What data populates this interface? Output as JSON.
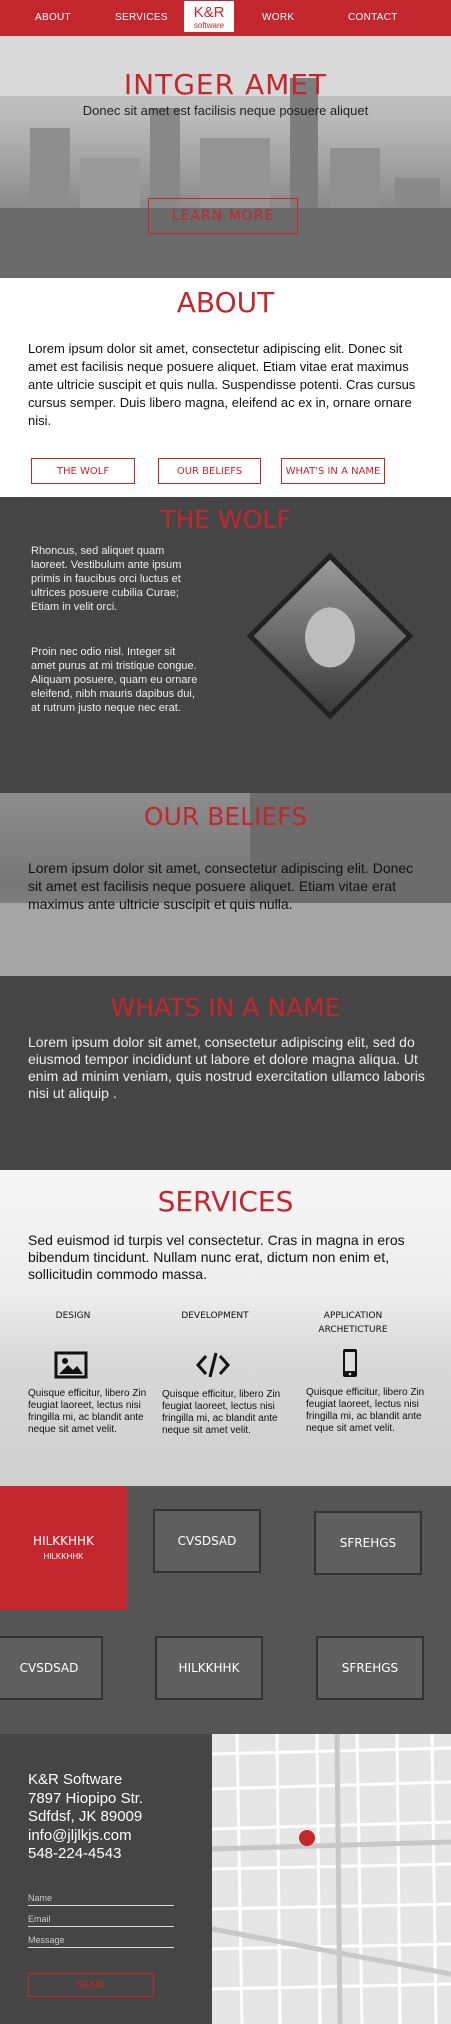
{
  "nav": {
    "items": [
      "ABOUT",
      "SERVICES",
      "WORK",
      "CONTACT"
    ],
    "logo_main": "K&R",
    "logo_sub": "software"
  },
  "hero": {
    "title": "INTGER AMET",
    "subtitle": "Donec sit amet est facilisis neque posuere aliquet",
    "button": "LEARN MORE"
  },
  "about": {
    "title": "ABOUT",
    "text": "Lorem ipsum dolor sit amet, consectetur adipiscing elit. Donec sit amet est facilisis neque posuere aliquet. Etiam vitae erat maximus ante ultricie suscipit et quis nulla. Suspendisse potenti. Cras cursus cursus semper. Duis libero magna, eleifend ac ex in, ornare ornare nisi.",
    "buttons": [
      "THE WOLF",
      "OUR BELIEFS",
      "WHAT'S IN A NAME"
    ]
  },
  "wolf": {
    "title": "THE WOLF",
    "para1": "Rhoncus, sed aliquet quam laoreet. Vestibulum ante ipsum primis in faucibus orci luctus et ultrices posuere cubilia Curae; Etiam in velit orci.",
    "para2": "Proin nec odio nisl. Integer sit amet purus at mi tristique congue. Aliquam posuere, quam eu ornare eleifend, nibh mauris dapibus dui, at rutrum justo neque nec erat."
  },
  "beliefs": {
    "title": "OUR BELIEFS",
    "text": "Lorem ipsum dolor sit amet, consectetur adipiscing elit. Donec sit amet est facilisis neque posuere aliquet. Etiam vitae erat maximus ante ultricie suscipit et quis nulla."
  },
  "whats": {
    "title": "WHATS IN A NAME",
    "text": "Lorem ipsum dolor sit amet, consectetur adipiscing elit, sed do eiusmod tempor incididunt ut labore et dolore magna aliqua. Ut enim ad minim veniam, quis nostrud exercitation ullamco laboris nisi ut aliquip ."
  },
  "services": {
    "title": "SERVICES",
    "text": "Sed euismod id turpis vel consectetur. Cras in magna in eros bibendum tincidunt. Nullam nunc erat, dictum non enim et, sollicitudin commodo massa.",
    "columns": [
      {
        "title": "DESIGN",
        "icon": "image-icon",
        "text": "Quisque efficitur, libero Zin feugiat laoreet, lectus nisi fringilla mi, ac blandit ante neque sit amet velit."
      },
      {
        "title": "DEVELOPMENT",
        "icon": "code-icon",
        "text": "Quisque efficitur, libero Zin feugiat laoreet, lectus nisi fringilla mi, ac blandit ante neque sit amet velit."
      },
      {
        "title": "APPLICATION ARCHETICTURE",
        "icon": "phone-icon",
        "text": "Quisque efficitur, libero Zin feugiat laoreet, lectus nisi fringilla mi, ac blandit ante neque sit amet velit."
      }
    ]
  },
  "work": {
    "featured_title": "HILKKHHK",
    "featured_sub": "HILKKHHK",
    "tiles": [
      "CVSDSAD",
      "SFREHGS",
      "CVSDSAD",
      "HILKKHHK",
      "SFREHGS"
    ]
  },
  "contact": {
    "lines": [
      "K&R Software",
      "7897 Hiopipo Str.",
      "Sdfdsf, JK 89009",
      "info@jljlkjs.com",
      "548-224-4543"
    ],
    "name_placeholder": "Name",
    "email_placeholder": "Email",
    "message_placeholder": "Message",
    "send_label": "SEND"
  },
  "colors": {
    "accent": "#c4262e",
    "dark": "#454545"
  }
}
